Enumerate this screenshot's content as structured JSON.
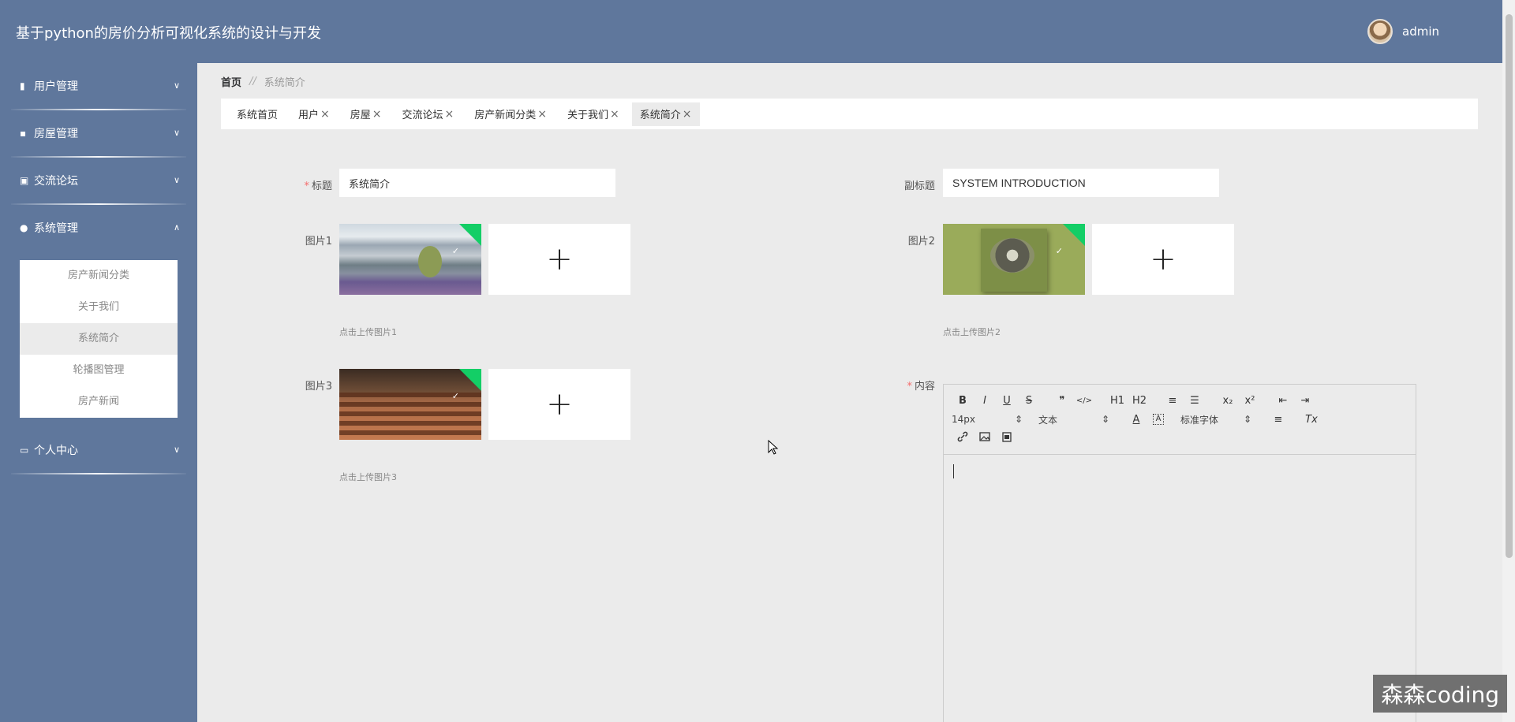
{
  "header": {
    "title": "基于python的房价分析可视化系统的设计与开发",
    "username": "admin"
  },
  "sidebar": {
    "groups": [
      {
        "label": "用户管理",
        "icon": "clipboard-icon",
        "chevron": "chevron-down-icon"
      },
      {
        "label": "房屋管理",
        "icon": "chat-bubble-icon",
        "chevron": "chevron-down-icon"
      },
      {
        "label": "交流论坛",
        "icon": "clipboard-check-icon",
        "chevron": "chevron-down-icon"
      },
      {
        "label": "系统管理",
        "icon": "user-icon",
        "chevron": "chevron-up-icon",
        "items": [
          "房产新闻分类",
          "关于我们",
          "系统简介",
          "轮播图管理",
          "房产新闻"
        ],
        "active_item": "系统简介"
      },
      {
        "label": "个人中心",
        "icon": "card-icon",
        "chevron": "chevron-down-icon"
      }
    ]
  },
  "breadcrumb": {
    "home": "首页",
    "separator": "//",
    "current": "系统简介"
  },
  "tabs": [
    {
      "label": "系统首页",
      "closable": false
    },
    {
      "label": "用户",
      "closable": true
    },
    {
      "label": "房屋",
      "closable": true
    },
    {
      "label": "交流论坛",
      "closable": true
    },
    {
      "label": "房产新闻分类",
      "closable": true
    },
    {
      "label": "关于我们",
      "closable": true
    },
    {
      "label": "系统简介",
      "closable": true,
      "active": true
    }
  ],
  "tab_close_glyph": "×",
  "form": {
    "title_label": "标题",
    "title_value": "系统简介",
    "subtitle_label": "副标题",
    "subtitle_value": "SYSTEM INTRODUCTION",
    "image1_label": "图片1",
    "image1_hint": "点击上传图片1",
    "image2_label": "图片2",
    "image2_hint": "点击上传图片2",
    "image3_label": "图片3",
    "image3_hint": "点击上传图片3",
    "content_label": "内容",
    "required_mark": "*",
    "upload_glyph": "+"
  },
  "editor": {
    "row1": [
      "B",
      "I",
      "U",
      "S",
      "❞",
      "</>",
      "H1",
      "H2",
      "≡",
      "☰",
      "x₂",
      "x²",
      "⇤",
      "⇥"
    ],
    "font_size": "14px",
    "header_type": "文本",
    "font_family": "标准字体",
    "row3_icons": [
      "link-icon",
      "image-icon",
      "video-icon"
    ]
  },
  "watermark": "森森coding",
  "colors": {
    "header": "#5f779c",
    "sidebar": "#5f779c",
    "required": "#f56c6c",
    "upload_success": "#13ce66"
  }
}
